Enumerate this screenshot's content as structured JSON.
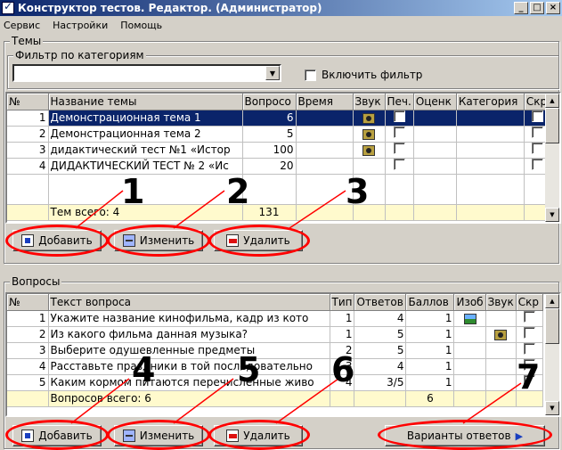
{
  "window": {
    "title": "Конструктор тестов. Редактор. (Администратор)",
    "min": "_",
    "max": "□",
    "close": "×"
  },
  "menu": [
    "Сервис",
    "Настройки",
    "Помощь"
  ],
  "topics": {
    "group_label": "Темы",
    "filter_label": "Фильтр по категориям",
    "filter_value": "",
    "enable_filter_label": "Включить фильтр",
    "columns": [
      "№",
      "Название темы",
      "Вопросо",
      "Время",
      "Звук",
      "Печ.",
      "Оценк",
      "Категория",
      "Скр"
    ],
    "rows": [
      {
        "n": "1",
        "name": "Демонстрационная тема 1",
        "questions": "6",
        "time": "",
        "sound": "звук-icon"
      },
      {
        "n": "2",
        "name": "Демонстрационная тема 2",
        "questions": "5",
        "time": "",
        "sound": "sound-icon"
      },
      {
        "n": "3",
        "name": "дидактический тест №1 «Истор",
        "questions": "100",
        "time": "",
        "sound": "sound-icon"
      },
      {
        "n": "4",
        "name": "ДИДАКТИЧЕСКИЙ ТЕСТ № 2 «Ис",
        "questions": "20",
        "time": "",
        "sound": ""
      }
    ],
    "total_label": "Тем всего: 4",
    "total_questions": "131",
    "add_label": "Добавить",
    "edit_label": "Изменить",
    "delete_label": "Удалить"
  },
  "questions": {
    "group_label": "Вопросы",
    "columns": [
      "№",
      "Текст вопроса",
      "Тип",
      "Ответов",
      "Баллов",
      "Изоб",
      "Звук",
      "Скр"
    ],
    "rows": [
      {
        "n": "1",
        "text": "Укажите название кинофильма, кадр из кото",
        "type": "1",
        "answers": "4",
        "points": "1"
      },
      {
        "n": "2",
        "text": "Из какого фильма данная музыка?",
        "type": "1",
        "answers": "5",
        "points": "1"
      },
      {
        "n": "3",
        "text": "Выберите одушевленные предметы",
        "type": "2",
        "answers": "5",
        "points": "1"
      },
      {
        "n": "4",
        "text": "Расставьте праздники в той последовательно",
        "type": "3",
        "answers": "4",
        "points": "1"
      },
      {
        "n": "5",
        "text": "Каким кормом питаются перечисленные живо",
        "type": "4",
        "answers": "3/5",
        "points": "1"
      }
    ],
    "total_label": "Вопросов всего: 6",
    "total_points": "6",
    "add_label": "Добавить",
    "edit_label": "Изменить",
    "delete_label": "Удалить",
    "variants_label": "Варианты ответов"
  },
  "annotations": [
    "1",
    "2",
    "3",
    "4",
    "5",
    "6",
    "7"
  ],
  "colors": {
    "selection": "#0a246a",
    "annotation_ring": "#ff0000",
    "footer_bg": "#fffacd"
  }
}
